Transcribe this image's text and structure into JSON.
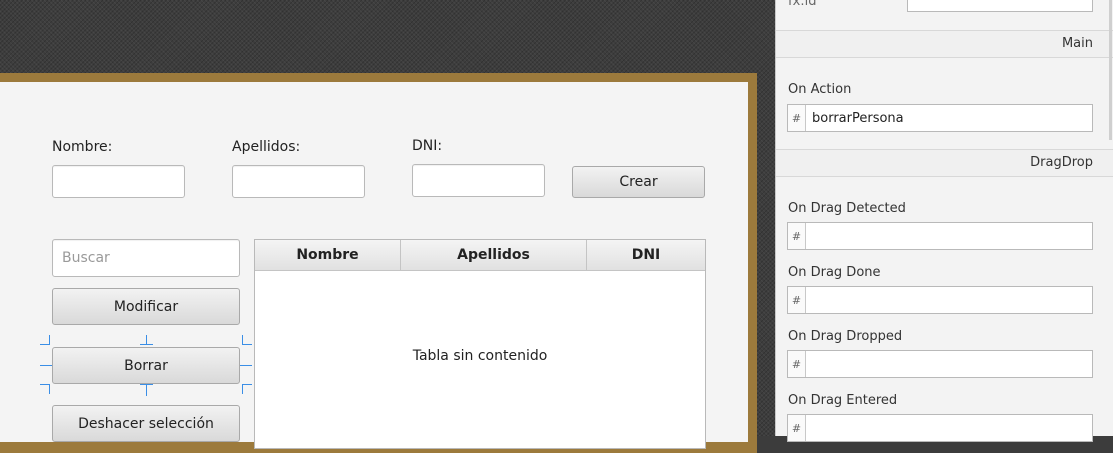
{
  "form": {
    "nombre_label": "Nombre:",
    "apellidos_label": "Apellidos:",
    "dni_label": "DNI:",
    "nombre_value": "",
    "apellidos_value": "",
    "dni_value": "",
    "crear_button": "Crear",
    "buscar_placeholder": "Buscar",
    "buscar_value": "",
    "modificar_button": "Modificar",
    "borrar_button": "Borrar",
    "deshacer_button": "Deshacer selección"
  },
  "table": {
    "columns": [
      "Nombre",
      "Apellidos",
      "DNI"
    ],
    "empty_text": "Tabla sin contenido",
    "rows": []
  },
  "inspector": {
    "fx_id_label": "fx:id",
    "fx_id_value": "",
    "section_main": "Main",
    "on_action_label": "On Action",
    "on_action_value": "borrarPersona",
    "section_dragdrop": "DragDrop",
    "hash_symbol": "#",
    "events": [
      {
        "label": "On Drag Detected",
        "value": ""
      },
      {
        "label": "On Drag Done",
        "value": ""
      },
      {
        "label": "On Drag Dropped",
        "value": ""
      },
      {
        "label": "On Drag Entered",
        "value": ""
      }
    ]
  },
  "colors": {
    "stage_border": "#9c7a3c",
    "selection_guides": "#3a8ee6"
  }
}
